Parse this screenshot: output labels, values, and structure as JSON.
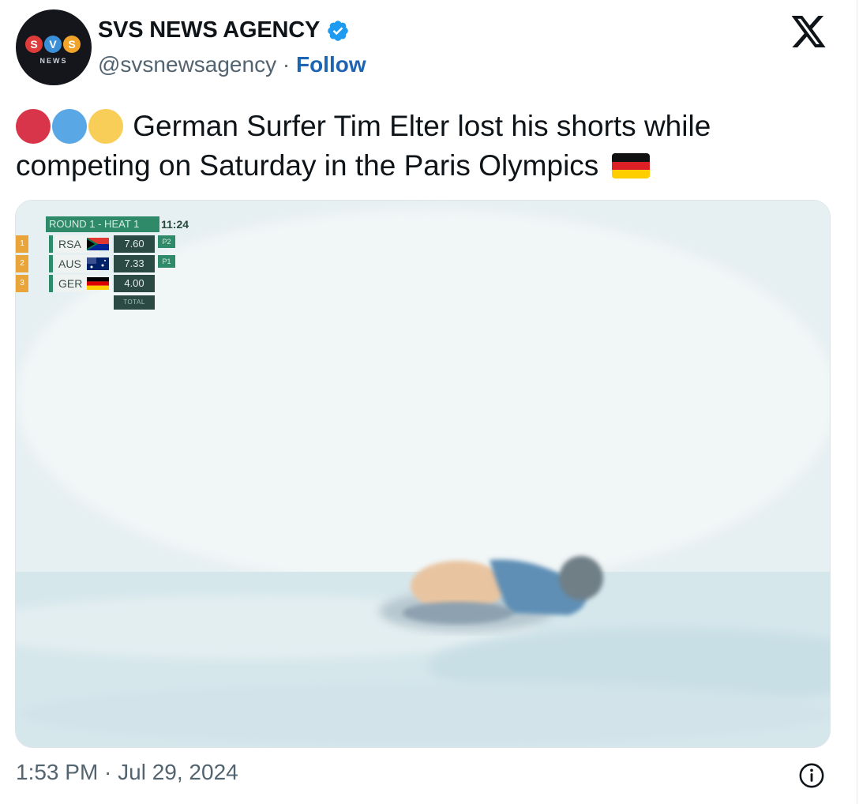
{
  "account": {
    "name": "SVS NEWS AGENCY",
    "handle": "@svsnewsagency",
    "separator": "·",
    "follow_label": "Follow",
    "verified_icon": "verified-badge-icon",
    "avatar": {
      "letters": [
        "S",
        "V",
        "S"
      ],
      "subtitle": "NEWS",
      "colors": [
        "#e03b3b",
        "#3b8fd8",
        "#f0a52a"
      ]
    }
  },
  "platform_icon": "x-logo-icon",
  "tweet": {
    "emoji_prefix": [
      "red-circle",
      "blue-circle",
      "yellow-circle"
    ],
    "text": "German Surfer Tim Elter lost his shorts while competing on Saturday in the Paris Olympics",
    "emoji_suffix": "germany-flag"
  },
  "media": {
    "scoreboard": {
      "header": "ROUND 1 - HEAT 1",
      "clock": "11:24",
      "rows": [
        {
          "rank": "1",
          "country": "RSA",
          "flag": "south-africa-flag",
          "score": "7.60",
          "position": "P2"
        },
        {
          "rank": "2",
          "country": "AUS",
          "flag": "australia-flag",
          "score": "7.33",
          "position": "P1"
        },
        {
          "rank": "3",
          "country": "GER",
          "flag": "germany-flag",
          "score": "4.00",
          "position": ""
        }
      ],
      "total_label": "TOTAL"
    }
  },
  "footer": {
    "timestamp": "1:53 PM · Jul 29, 2024",
    "info_icon": "info-icon"
  },
  "colors": {
    "text": "#0f1419",
    "secondary_text": "#536471",
    "follow": "#1d64b3",
    "verified": "#1d9bf0"
  }
}
